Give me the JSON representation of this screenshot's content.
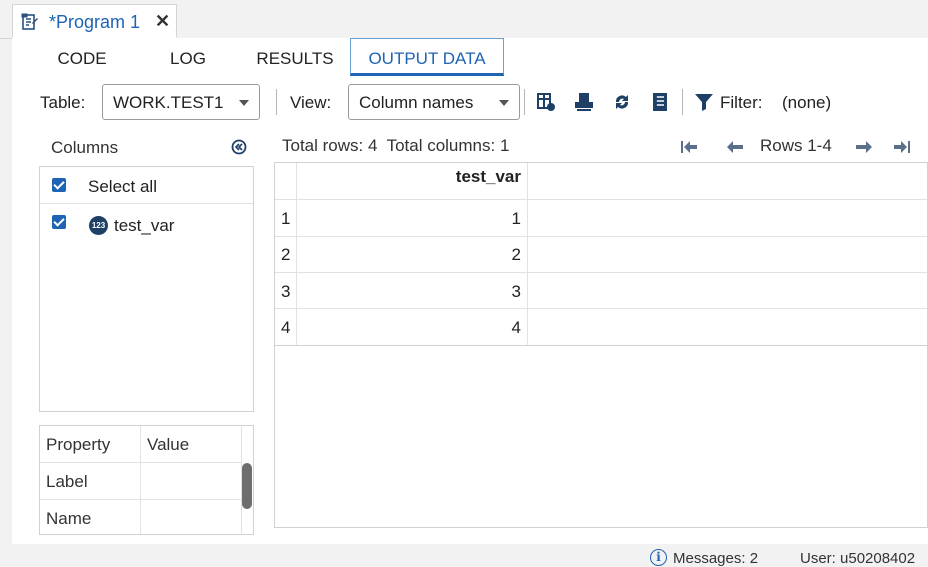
{
  "program_tab": {
    "title": "*Program 1",
    "close_glyph": "✕"
  },
  "subtabs": [
    {
      "label": "CODE",
      "active": false
    },
    {
      "label": "LOG",
      "active": false
    },
    {
      "label": "RESULTS",
      "active": false
    },
    {
      "label": "OUTPUT DATA",
      "active": true
    }
  ],
  "toolbar": {
    "table_label": "Table:",
    "table_value": "WORK.TEST1",
    "view_label": "View:",
    "view_value": "Column names",
    "filter_label": "Filter:",
    "filter_value": "(none)"
  },
  "columns_panel": {
    "title": "Columns",
    "select_all_label": "Select all",
    "columns": [
      {
        "name": "test_var",
        "type_badge": "123",
        "checked": true
      }
    ]
  },
  "properties": {
    "headers": [
      "Property",
      "Value"
    ],
    "rows": [
      {
        "property": "Label",
        "value": ""
      },
      {
        "property": "Name",
        "value": ""
      }
    ]
  },
  "grid": {
    "info": "Total rows: 4  Total columns: 1",
    "rows_range": "Rows 1-4",
    "column_header": "test_var",
    "rows": [
      {
        "index": "1",
        "value": "1"
      },
      {
        "index": "2",
        "value": "2"
      },
      {
        "index": "3",
        "value": "3"
      },
      {
        "index": "4",
        "value": "4"
      }
    ]
  },
  "status": {
    "messages": "Messages: 2",
    "user": "User: u50208402"
  },
  "colors": {
    "accent": "#1e63b4",
    "badge": "#1e3f66"
  }
}
